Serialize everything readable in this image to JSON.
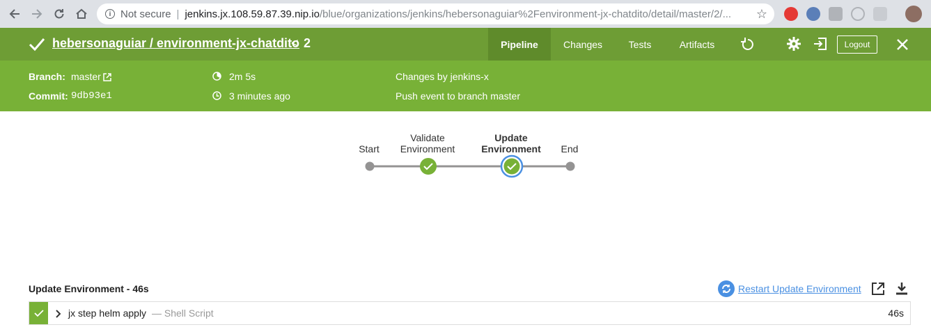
{
  "browser": {
    "security_label": "Not secure",
    "url_host": "jenkins.jx.108.59.87.39.nip.io",
    "url_path": "/blue/organizations/jenkins/hebersonaguiar%2Fenvironment-jx-chatdito/detail/master/2/..."
  },
  "header": {
    "title": "hebersonaguiar / environment-jx-chatdito",
    "run_number": "2",
    "tabs": [
      {
        "label": "Pipeline"
      },
      {
        "label": "Changes"
      },
      {
        "label": "Tests"
      },
      {
        "label": "Artifacts"
      }
    ],
    "logout_label": "Logout"
  },
  "summary": {
    "branch_label": "Branch:",
    "branch_value": "master",
    "commit_label": "Commit:",
    "commit_value": "9db93e1",
    "duration": "2m 5s",
    "time_ago": "3 minutes ago",
    "changes": "Changes by jenkins-x",
    "cause": "Push event to branch master"
  },
  "pipeline": {
    "stages": [
      {
        "line1": "",
        "line2": "Start",
        "status": "none"
      },
      {
        "line1": "Validate",
        "line2": "Environment",
        "status": "success"
      },
      {
        "line1": "Update",
        "line2": "Environment",
        "status": "success-selected"
      },
      {
        "line1": "",
        "line2": "End",
        "status": "none"
      }
    ]
  },
  "step_section": {
    "title": "Update Environment - 46s",
    "restart_label": "Restart Update Environment",
    "steps": [
      {
        "name": "jx step helm apply",
        "description": "— Shell Script",
        "duration": "46s",
        "status": "success"
      }
    ]
  },
  "colors": {
    "header_green": "#6e9d35",
    "summary_green": "#78b137",
    "success_green": "#78b137",
    "selected_blue": "#4a90e2",
    "link_blue": "#4a90e2"
  }
}
